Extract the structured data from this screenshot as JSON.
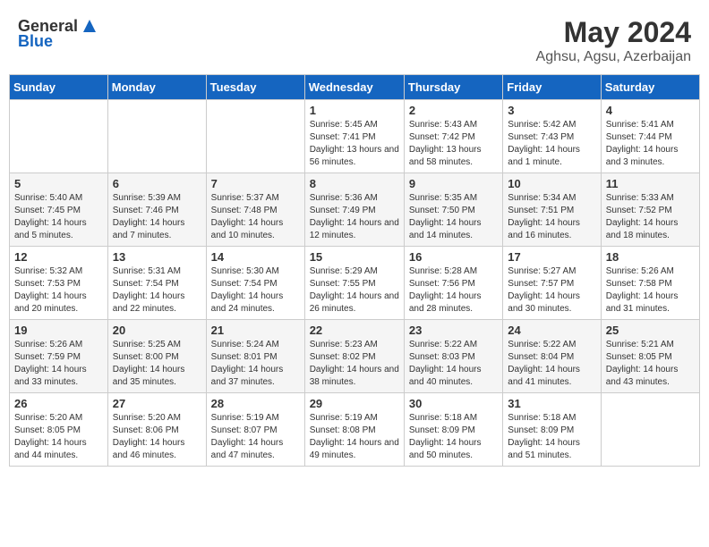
{
  "logo": {
    "general": "General",
    "blue": "Blue"
  },
  "title": "May 2024",
  "subtitle": "Aghsu, Agsu, Azerbaijan",
  "days_of_week": [
    "Sunday",
    "Monday",
    "Tuesday",
    "Wednesday",
    "Thursday",
    "Friday",
    "Saturday"
  ],
  "weeks": [
    [
      {
        "day": "",
        "info": ""
      },
      {
        "day": "",
        "info": ""
      },
      {
        "day": "",
        "info": ""
      },
      {
        "day": "1",
        "info": "Sunrise: 5:45 AM\nSunset: 7:41 PM\nDaylight: 13 hours and 56 minutes."
      },
      {
        "day": "2",
        "info": "Sunrise: 5:43 AM\nSunset: 7:42 PM\nDaylight: 13 hours and 58 minutes."
      },
      {
        "day": "3",
        "info": "Sunrise: 5:42 AM\nSunset: 7:43 PM\nDaylight: 14 hours and 1 minute."
      },
      {
        "day": "4",
        "info": "Sunrise: 5:41 AM\nSunset: 7:44 PM\nDaylight: 14 hours and 3 minutes."
      }
    ],
    [
      {
        "day": "5",
        "info": "Sunrise: 5:40 AM\nSunset: 7:45 PM\nDaylight: 14 hours and 5 minutes."
      },
      {
        "day": "6",
        "info": "Sunrise: 5:39 AM\nSunset: 7:46 PM\nDaylight: 14 hours and 7 minutes."
      },
      {
        "day": "7",
        "info": "Sunrise: 5:37 AM\nSunset: 7:48 PM\nDaylight: 14 hours and 10 minutes."
      },
      {
        "day": "8",
        "info": "Sunrise: 5:36 AM\nSunset: 7:49 PM\nDaylight: 14 hours and 12 minutes."
      },
      {
        "day": "9",
        "info": "Sunrise: 5:35 AM\nSunset: 7:50 PM\nDaylight: 14 hours and 14 minutes."
      },
      {
        "day": "10",
        "info": "Sunrise: 5:34 AM\nSunset: 7:51 PM\nDaylight: 14 hours and 16 minutes."
      },
      {
        "day": "11",
        "info": "Sunrise: 5:33 AM\nSunset: 7:52 PM\nDaylight: 14 hours and 18 minutes."
      }
    ],
    [
      {
        "day": "12",
        "info": "Sunrise: 5:32 AM\nSunset: 7:53 PM\nDaylight: 14 hours and 20 minutes."
      },
      {
        "day": "13",
        "info": "Sunrise: 5:31 AM\nSunset: 7:54 PM\nDaylight: 14 hours and 22 minutes."
      },
      {
        "day": "14",
        "info": "Sunrise: 5:30 AM\nSunset: 7:54 PM\nDaylight: 14 hours and 24 minutes."
      },
      {
        "day": "15",
        "info": "Sunrise: 5:29 AM\nSunset: 7:55 PM\nDaylight: 14 hours and 26 minutes."
      },
      {
        "day": "16",
        "info": "Sunrise: 5:28 AM\nSunset: 7:56 PM\nDaylight: 14 hours and 28 minutes."
      },
      {
        "day": "17",
        "info": "Sunrise: 5:27 AM\nSunset: 7:57 PM\nDaylight: 14 hours and 30 minutes."
      },
      {
        "day": "18",
        "info": "Sunrise: 5:26 AM\nSunset: 7:58 PM\nDaylight: 14 hours and 31 minutes."
      }
    ],
    [
      {
        "day": "19",
        "info": "Sunrise: 5:26 AM\nSunset: 7:59 PM\nDaylight: 14 hours and 33 minutes."
      },
      {
        "day": "20",
        "info": "Sunrise: 5:25 AM\nSunset: 8:00 PM\nDaylight: 14 hours and 35 minutes."
      },
      {
        "day": "21",
        "info": "Sunrise: 5:24 AM\nSunset: 8:01 PM\nDaylight: 14 hours and 37 minutes."
      },
      {
        "day": "22",
        "info": "Sunrise: 5:23 AM\nSunset: 8:02 PM\nDaylight: 14 hours and 38 minutes."
      },
      {
        "day": "23",
        "info": "Sunrise: 5:22 AM\nSunset: 8:03 PM\nDaylight: 14 hours and 40 minutes."
      },
      {
        "day": "24",
        "info": "Sunrise: 5:22 AM\nSunset: 8:04 PM\nDaylight: 14 hours and 41 minutes."
      },
      {
        "day": "25",
        "info": "Sunrise: 5:21 AM\nSunset: 8:05 PM\nDaylight: 14 hours and 43 minutes."
      }
    ],
    [
      {
        "day": "26",
        "info": "Sunrise: 5:20 AM\nSunset: 8:05 PM\nDaylight: 14 hours and 44 minutes."
      },
      {
        "day": "27",
        "info": "Sunrise: 5:20 AM\nSunset: 8:06 PM\nDaylight: 14 hours and 46 minutes."
      },
      {
        "day": "28",
        "info": "Sunrise: 5:19 AM\nSunset: 8:07 PM\nDaylight: 14 hours and 47 minutes."
      },
      {
        "day": "29",
        "info": "Sunrise: 5:19 AM\nSunset: 8:08 PM\nDaylight: 14 hours and 49 minutes."
      },
      {
        "day": "30",
        "info": "Sunrise: 5:18 AM\nSunset: 8:09 PM\nDaylight: 14 hours and 50 minutes."
      },
      {
        "day": "31",
        "info": "Sunrise: 5:18 AM\nSunset: 8:09 PM\nDaylight: 14 hours and 51 minutes."
      },
      {
        "day": "",
        "info": ""
      }
    ]
  ]
}
